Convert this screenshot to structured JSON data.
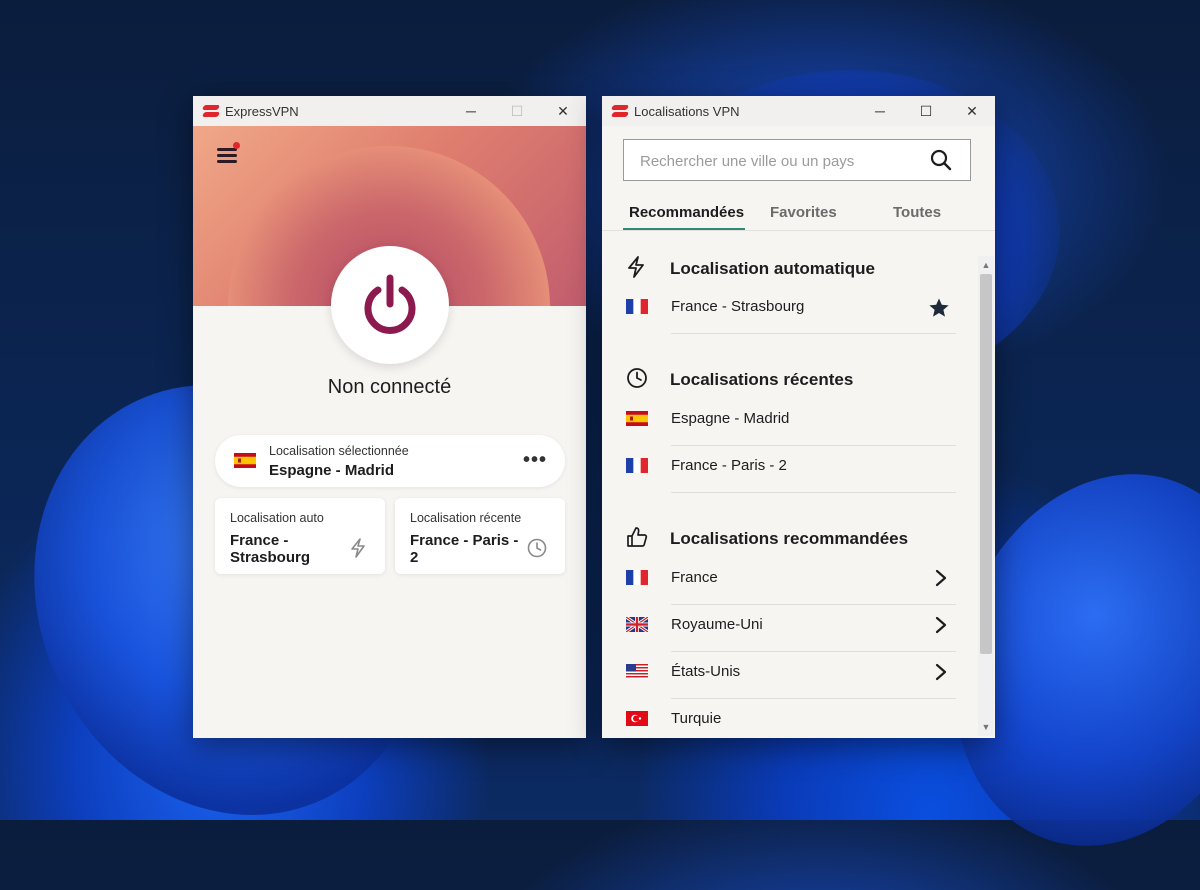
{
  "colors": {
    "accent": "#2e8a72",
    "power": "#8c1a4f",
    "brand_red": "#e0262c"
  },
  "left_window": {
    "title": "ExpressVPN",
    "status": "Non connecté",
    "selected": {
      "label": "Localisation sélectionnée",
      "value": "Espagne - Madrid",
      "flag": "flag-spain"
    },
    "auto_card": {
      "label": "Localisation auto",
      "value": "France - Strasbourg",
      "icon": "bolt-icon"
    },
    "recent_card": {
      "label": "Localisation récente",
      "value": "France - Paris - 2",
      "icon": "clock-icon"
    }
  },
  "right_window": {
    "title": "Localisations VPN",
    "search_placeholder": "Rechercher une ville ou un pays",
    "tabs": [
      "Recommandées",
      "Favorites",
      "Toutes"
    ],
    "sections": {
      "auto": {
        "title": "Localisation automatique",
        "items": [
          "France - Strasbourg"
        ]
      },
      "recent": {
        "title": "Localisations récentes",
        "items": [
          "Espagne - Madrid",
          "France - Paris - 2"
        ]
      },
      "recommended": {
        "title": "Localisations recommandées",
        "items": [
          "France",
          "Royaume-Uni",
          "États-Unis",
          "Turquie"
        ]
      }
    }
  }
}
